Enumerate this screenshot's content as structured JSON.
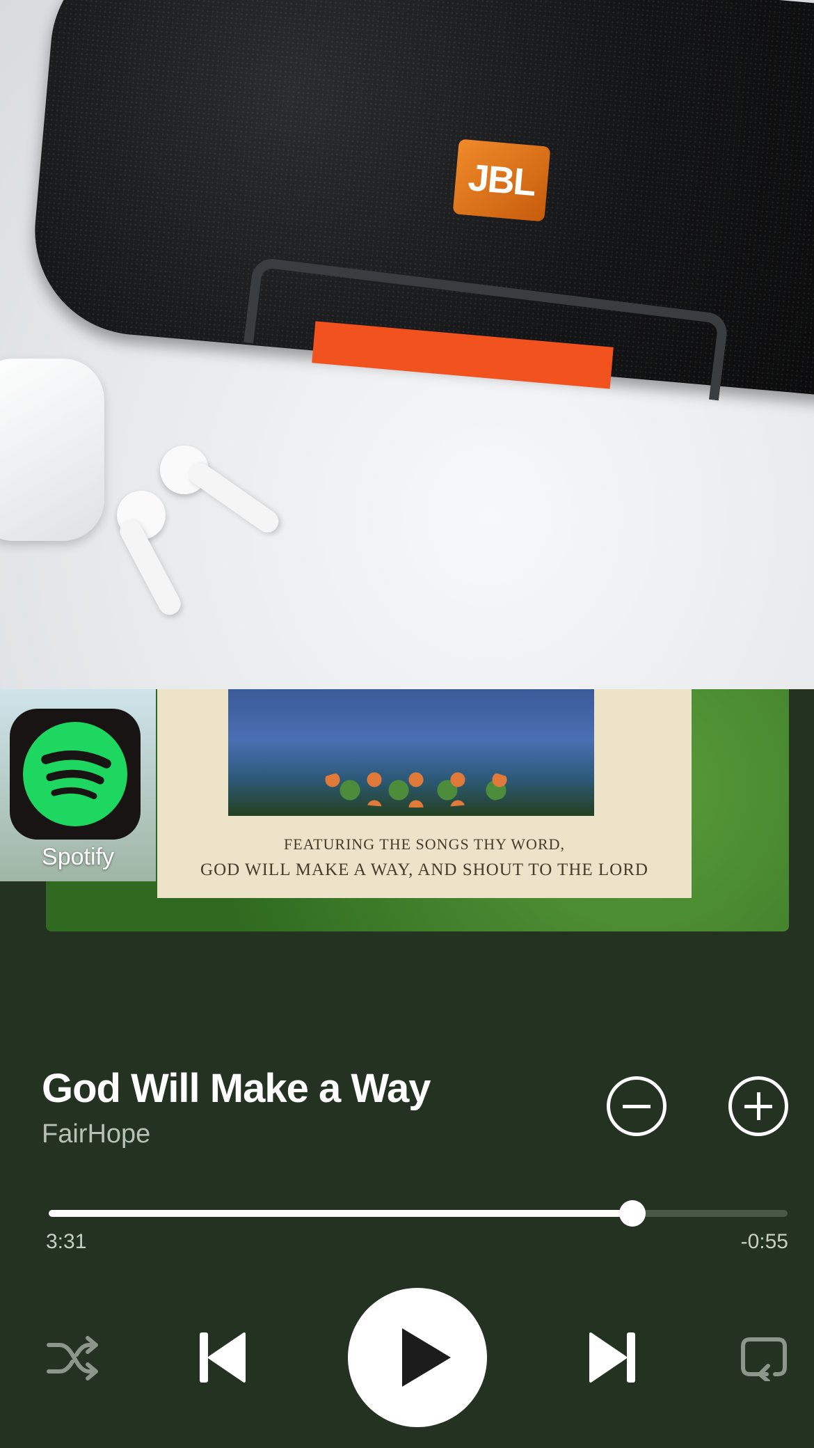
{
  "photo": {
    "speaker_logo_text": "JBL"
  },
  "album": {
    "caption_line1": "FEATURING THE SONGS THY WORD,",
    "caption_line2": "GOD WILL MAKE A WAY, AND SHOUT TO THE LORD"
  },
  "badge": {
    "app_name": "Spotify",
    "icon": "spotify-icon",
    "accent": "#1ed760"
  },
  "track": {
    "title": "God Will Make a Way",
    "artist": "FairHope"
  },
  "actions": {
    "remove_icon": "minus-circle-icon",
    "add_icon": "plus-circle-icon"
  },
  "progress": {
    "elapsed": "3:31",
    "remaining": "-0:55",
    "fraction": 0.79
  },
  "controls": {
    "shuffle_icon": "shuffle-icon",
    "previous_icon": "previous-icon",
    "play_icon": "play-icon",
    "next_icon": "next-icon",
    "repeat_icon": "repeat-icon"
  },
  "colors": {
    "background": "#233221",
    "text": "#ffffff",
    "muted": "#b9c0b6"
  }
}
